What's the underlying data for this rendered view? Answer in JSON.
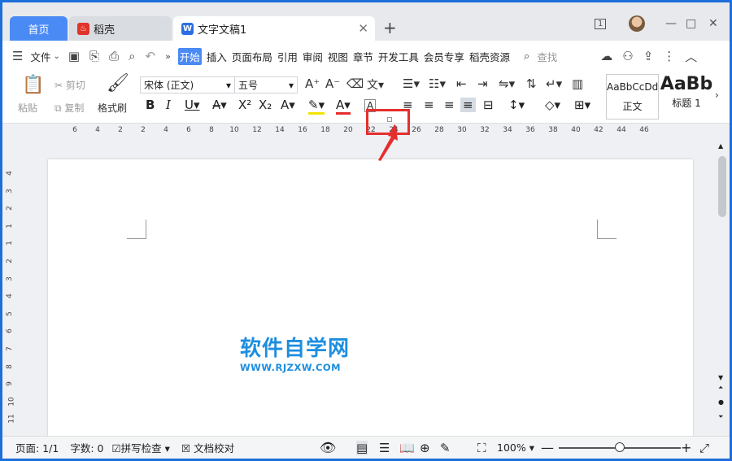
{
  "tabs": {
    "home": "首页",
    "daoke": "稻壳",
    "doc": "文字文稿1"
  },
  "window": {
    "badge": "1",
    "minimize": "—",
    "restore": "□",
    "close": "✕",
    "new_tab": "+"
  },
  "menu": {
    "file": "文件",
    "items": [
      "开始",
      "插入",
      "页面布局",
      "引用",
      "审阅",
      "视图",
      "章节",
      "开发工具",
      "会员专享",
      "稻壳资源"
    ],
    "search": "查找"
  },
  "ribbon": {
    "paste": "粘贴",
    "cut": "剪切",
    "copy": "复制",
    "format_painter": "格式刷",
    "font_name": "宋体 (正文)",
    "font_size": "五号",
    "styles": [
      {
        "sample": "AaBbCcDd",
        "name": "正文"
      },
      {
        "sample": "AaBb",
        "name": "标题 1"
      }
    ]
  },
  "ruler": {
    "h_ticks": [
      "6",
      "4",
      "2",
      "2",
      "4",
      "6",
      "8",
      "10",
      "12",
      "14",
      "16",
      "18",
      "20",
      "22",
      "24",
      "26",
      "28",
      "30",
      "32",
      "34",
      "36",
      "38",
      "40",
      "42",
      "44",
      "46"
    ],
    "v_ticks": [
      "4",
      "3",
      "2",
      "1",
      "1",
      "2",
      "3",
      "4",
      "5",
      "6",
      "7",
      "8",
      "9",
      "10",
      "11"
    ]
  },
  "watermark": {
    "title": "软件自学网",
    "url": "WWW.RJZXW.COM"
  },
  "status": {
    "page": "页面: 1/1",
    "words": "字数: 0",
    "spell": "拼写检查",
    "proof": "文档校对",
    "zoom": "100%",
    "zoom_level": 0.5
  },
  "colors": {
    "accent": "#4a8af4",
    "highlight": "#e62e2e",
    "watermark": "#1d8ee0"
  }
}
